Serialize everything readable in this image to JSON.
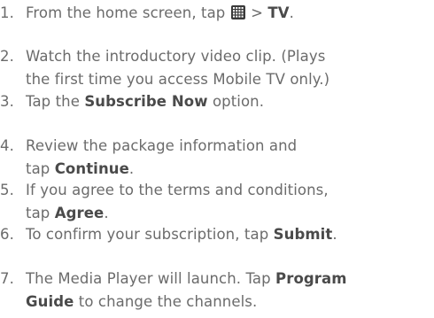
{
  "steps": [
    {
      "number": "1.",
      "lines": [
        {
          "parts": [
            {
              "t": "From the home screen, tap "
            },
            {
              "icon": "apps-grid-icon"
            },
            {
              "t": " > "
            },
            {
              "t": "TV",
              "b": true
            },
            {
              "t": "."
            }
          ]
        }
      ]
    },
    {
      "number": "2.",
      "lines": [
        {
          "parts": [
            {
              "t": "Watch the introductory video clip. (Plays"
            }
          ]
        },
        {
          "parts": [
            {
              "t": "the first time you access Mobile TV only.)"
            }
          ]
        }
      ]
    },
    {
      "number": "3.",
      "lines": [
        {
          "parts": [
            {
              "t": "Tap the "
            },
            {
              "t": "Subscribe Now",
              "b": true
            },
            {
              "t": " option."
            }
          ]
        }
      ]
    },
    {
      "number": "4.",
      "lines": [
        {
          "parts": [
            {
              "t": "Review the package information and"
            }
          ]
        },
        {
          "parts": [
            {
              "t": "tap "
            },
            {
              "t": "Continue",
              "b": true
            },
            {
              "t": "."
            }
          ]
        }
      ]
    },
    {
      "number": "5.",
      "lines": [
        {
          "parts": [
            {
              "t": "If you agree to the terms and conditions,"
            }
          ]
        },
        {
          "parts": [
            {
              "t": "tap "
            },
            {
              "t": "Agree",
              "b": true
            },
            {
              "t": "."
            }
          ]
        }
      ]
    },
    {
      "number": "6.",
      "lines": [
        {
          "parts": [
            {
              "t": "To confirm your subscription, tap "
            },
            {
              "t": "Submit",
              "b": true
            },
            {
              "t": "."
            }
          ]
        }
      ]
    },
    {
      "number": "7.",
      "lines": [
        {
          "parts": [
            {
              "t": "The Media Player will launch. Tap "
            },
            {
              "t": "Program",
              "b": true
            }
          ]
        },
        {
          "parts": [
            {
              "t": "Guide",
              "b": true
            },
            {
              "t": " to change the channels."
            }
          ]
        }
      ]
    }
  ]
}
